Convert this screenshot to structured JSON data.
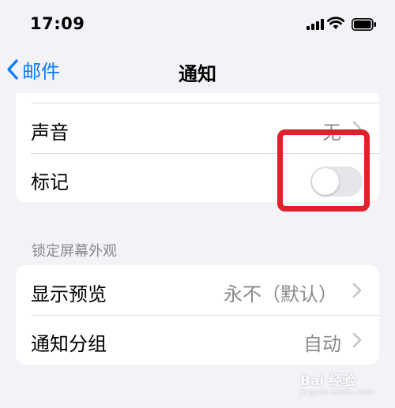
{
  "status_bar": {
    "time": "17:09"
  },
  "nav": {
    "back_label": "邮件",
    "title": "通知"
  },
  "group1": {
    "rows": [
      {
        "label": "声音",
        "value": "无"
      },
      {
        "label": "标记",
        "toggle_on": false
      }
    ]
  },
  "section_header": "锁定屏幕外观",
  "group2": {
    "rows": [
      {
        "label": "显示预览",
        "value": "永不（默认）"
      },
      {
        "label": "通知分组",
        "value": "自动"
      }
    ]
  },
  "watermark": {
    "text": "Bai 经验",
    "sub": "jingyan.baidu.com"
  },
  "colors": {
    "accent": "#0a7aff",
    "annotation": "#e0202a",
    "background": "#f2f2f7",
    "secondary_text": "#8a8a8e"
  }
}
